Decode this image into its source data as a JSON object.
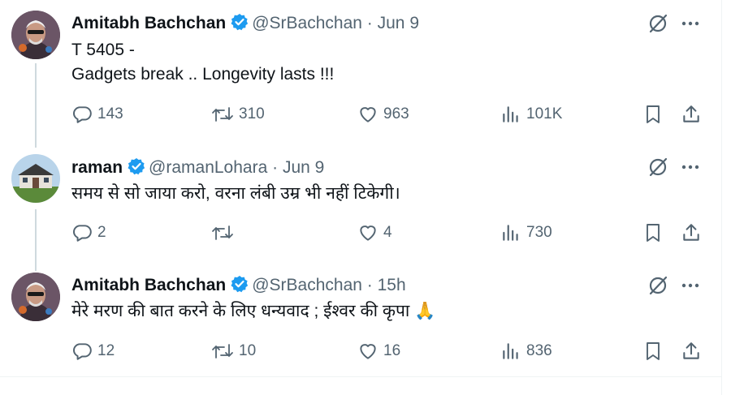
{
  "tweets": [
    {
      "name": "Amitabh Bachchan",
      "handle": "@SrBachchan",
      "separator": "·",
      "time": "Jun 9",
      "lines": [
        "T 5405 -",
        "Gadgets break .. Longevity lasts  !!!"
      ],
      "replies": "143",
      "reposts": "310",
      "likes": "963",
      "views": "101K"
    },
    {
      "name": "raman",
      "handle": "@ramanLohara",
      "separator": "·",
      "time": "Jun 9",
      "lines": [
        "समय से सो जाया करो, वरना लंबी उम्र भी नहीं टिकेगी।"
      ],
      "replies": "2",
      "reposts": "",
      "likes": "4",
      "views": "730"
    },
    {
      "name": "Amitabh Bachchan",
      "handle": "@SrBachchan",
      "separator": "·",
      "time": "15h",
      "lines": [
        "मेरे मरण की बात करने के लिए धन्यवाद  ; ईश्वर  की कृपा 🙏"
      ],
      "replies": "12",
      "reposts": "10",
      "likes": "16",
      "views": "836"
    }
  ],
  "colors": {
    "text": "#0f1419",
    "secondary": "#536471",
    "verified": "#1d9bf0",
    "thread_line": "#cfd9de"
  },
  "icons": [
    "verified-icon",
    "grok-icon",
    "more-icon",
    "reply-icon",
    "repost-icon",
    "like-icon",
    "views-icon",
    "bookmark-icon",
    "share-icon"
  ]
}
